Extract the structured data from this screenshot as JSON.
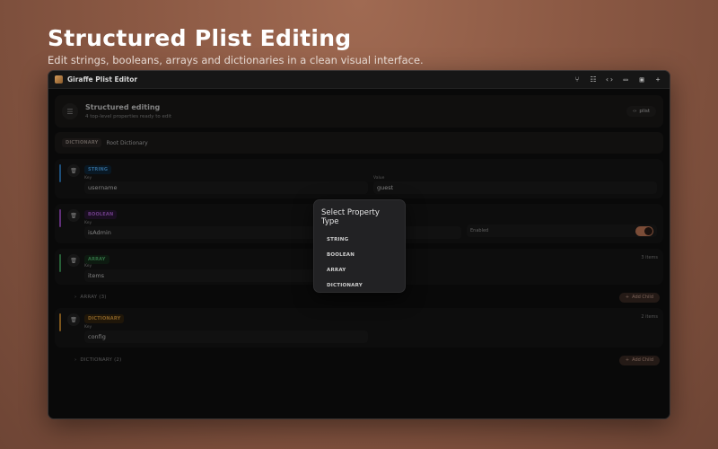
{
  "hero": {
    "title": "Structured Plist Editing",
    "subtitle": "Edit strings, booleans, arrays and dictionaries in a clean visual interface."
  },
  "window": {
    "title": "Giraffe Plist Editor",
    "toolbar_icons": [
      "branch-icon",
      "tree-icon",
      "code-icon",
      "folder-icon",
      "save-icon",
      "plus-icon"
    ]
  },
  "header": {
    "title": "Structured editing",
    "subtitle": "4 top-level properties ready to edit",
    "plist_button": "plist"
  },
  "root": {
    "tag": "DICTIONARY",
    "label": "Root Dictionary"
  },
  "properties": [
    {
      "type": "STRING",
      "key_label": "Key",
      "key": "username",
      "value_label": "Value",
      "value": "guest",
      "accent": "#2f7fc4"
    },
    {
      "type": "BOOLEAN",
      "key_label": "Key",
      "key": "isAdmin",
      "toggle_label": "Enabled",
      "toggle_on": true,
      "accent": "#9b4cc4"
    },
    {
      "type": "ARRAY",
      "key_label": "Key",
      "key": "items",
      "count": "3 items",
      "child_label": "ARRAY (3)",
      "add_child": "Add Child",
      "accent": "#3f9a5a"
    },
    {
      "type": "DICTIONARY",
      "key_label": "Key",
      "key": "config",
      "count": "2 items",
      "child_label": "DICTIONARY (2)",
      "add_child": "Add Child",
      "accent": "#c98a2e"
    }
  ],
  "popover": {
    "title": "Select Property Type",
    "options": [
      "STRING",
      "BOOLEAN",
      "ARRAY",
      "DICTIONARY"
    ]
  },
  "colors": {
    "accent": "#c77b5a",
    "string": "#4da3e8",
    "boolean": "#b062d8",
    "array": "#4eb06a",
    "dictionary": "#d69a3c"
  }
}
